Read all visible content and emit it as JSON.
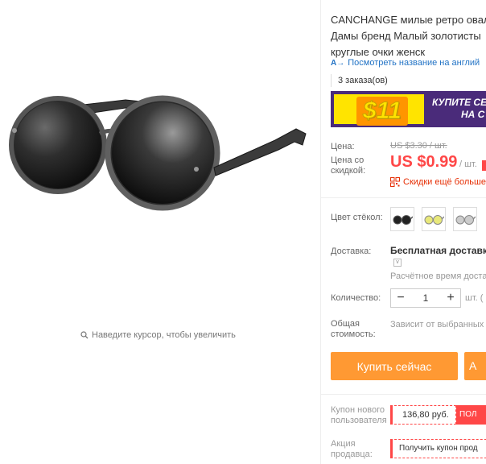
{
  "gallery": {
    "zoom_hint": "Наведите курсор, чтобы увеличить"
  },
  "product": {
    "title_lines": [
      "CANCHANGE милые ретро овал",
      "Дамы бренд Малый золотисты",
      "круглые очки женск"
    ],
    "translate_link": "Посмотреть название на англий",
    "orders": "3 заказа(ов)"
  },
  "banner": {
    "price": "$11",
    "text_line1": "КУПИТЕ СЕ",
    "text_line2": "НА С"
  },
  "price": {
    "label": "Цена:",
    "old": "US $3.30 / шт.",
    "discount_label_1": "Цена со",
    "discount_label_2": "скидкой:",
    "new": "US $0.99",
    "unit": "/ шт.",
    "more_discounts": "Скидки ещё больше"
  },
  "color": {
    "label": "Цвет стёкол:",
    "swatches": [
      "black-lens",
      "yellow-lens",
      "grey-lens"
    ]
  },
  "shipping": {
    "label": "Доставка:",
    "title": "Бесплатная доставка",
    "time": "Расчётное время доставк"
  },
  "quantity": {
    "label": "Количество:",
    "minus": "−",
    "value": "1",
    "plus": "+",
    "unit": "шт. ("
  },
  "total": {
    "label_1": "Общая",
    "label_2": "стоимость:",
    "value": "Зависит от выбранных"
  },
  "actions": {
    "buy_now": "Купить сейчас",
    "add_to_cart": "А"
  },
  "coupons": {
    "new_user_label_1": "Купон нового",
    "new_user_label_2": "пользователя",
    "new_user_value": "136,80 руб.",
    "new_user_button": "ПОЛ",
    "seller_label_1": "Акция",
    "seller_label_2": "продавца:",
    "seller_value": "Получить купон прод"
  },
  "colors": {
    "price_red": "#ff4747",
    "buy_orange": "#ff9933",
    "link_blue": "#2273c5",
    "banner_purple": "#4a2b7a",
    "banner_yellow": "#ffe400"
  }
}
